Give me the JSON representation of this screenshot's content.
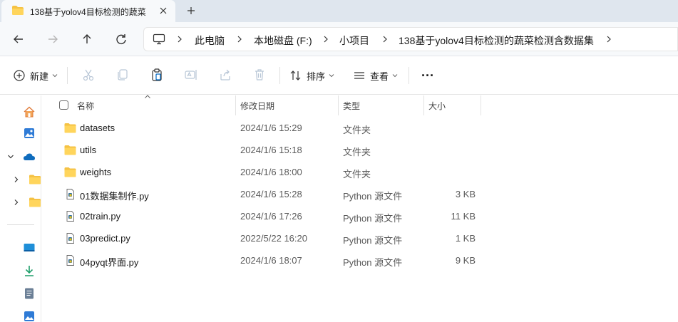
{
  "window": {
    "tab_title": "138基于yolov4目标检测的蔬菜检测含数据集",
    "tab_title_visible": "138基于yolov4目标检测的蔬菜"
  },
  "breadcrumbs": [
    "此电脑",
    "本地磁盘 (F:)",
    "小项目",
    "138基于yolov4目标检测的蔬菜检测含数据集"
  ],
  "toolbar": {
    "new_label": "新建",
    "sort_label": "排序",
    "view_label": "查看",
    "more_label": "···"
  },
  "columns": {
    "name": "名称",
    "modified": "修改日期",
    "type": "类型",
    "size": "大小"
  },
  "files": [
    {
      "name": "datasets",
      "modified": "2024/1/6 15:29",
      "type": "文件夹",
      "size": "",
      "kind": "folder"
    },
    {
      "name": "utils",
      "modified": "2024/1/6 15:18",
      "type": "文件夹",
      "size": "",
      "kind": "folder"
    },
    {
      "name": "weights",
      "modified": "2024/1/6 18:00",
      "type": "文件夹",
      "size": "",
      "kind": "folder"
    },
    {
      "name": "01数据集制作.py",
      "modified": "2024/1/6 15:28",
      "type": "Python 源文件",
      "size": "3 KB",
      "kind": "python"
    },
    {
      "name": "02train.py",
      "modified": "2024/1/6 17:26",
      "type": "Python 源文件",
      "size": "11 KB",
      "kind": "python"
    },
    {
      "name": "03predict.py",
      "modified": "2022/5/22 16:20",
      "type": "Python 源文件",
      "size": "1 KB",
      "kind": "python"
    },
    {
      "name": "04pyqt界面.py",
      "modified": "2024/1/6 18:07",
      "type": "Python 源文件",
      "size": "9 KB",
      "kind": "python"
    }
  ],
  "colors": {
    "folder": "#f5c244",
    "accent": "#0067c0",
    "tabbar_bg": "#dfe6ee"
  }
}
